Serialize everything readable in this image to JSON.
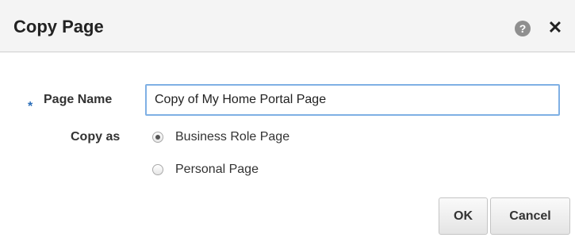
{
  "dialog": {
    "title": "Copy Page",
    "help_glyph": "?",
    "close_glyph": "✕"
  },
  "form": {
    "required_marker": "*",
    "page_name_label": "Page Name",
    "page_name_value": "Copy of My Home Portal Page",
    "copy_as_label": "Copy as",
    "copy_as_options": [
      {
        "label": "Business Role Page",
        "selected": true
      },
      {
        "label": "Personal Page",
        "selected": false
      }
    ]
  },
  "buttons": {
    "ok_label": "OK",
    "cancel_label": "Cancel"
  },
  "icons": {
    "help": "help-icon",
    "close": "close-icon"
  },
  "colors": {
    "title_bar": "#f4f4f4",
    "input_focus_border": "#7fb0e4",
    "required_marker": "#2a6db8"
  }
}
